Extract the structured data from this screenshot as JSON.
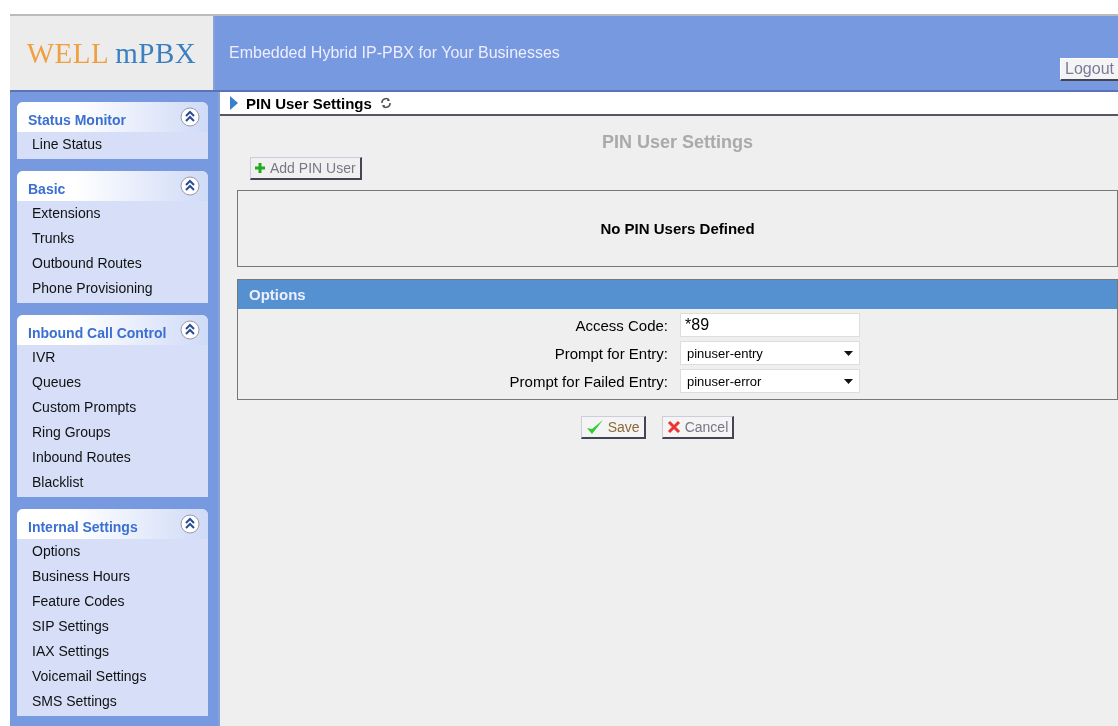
{
  "header": {
    "logo": {
      "part_1": "WELL",
      "part_2": "mPBX"
    },
    "tagline": "Embedded Hybrid IP-PBX for Your Businesses",
    "logout": "Logout"
  },
  "sidebar": {
    "sections": [
      {
        "title": "Status Monitor",
        "expanded": true,
        "items": [
          "Line Status"
        ]
      },
      {
        "title": "Basic",
        "expanded": true,
        "items": [
          "Extensions",
          "Trunks",
          "Outbound Routes",
          "Phone Provisioning"
        ]
      },
      {
        "title": "Inbound Call Control",
        "expanded": true,
        "items": [
          "IVR",
          "Queues",
          "Custom Prompts",
          "Ring Groups",
          "Inbound Routes",
          "Blacklist"
        ]
      },
      {
        "title": "Internal Settings",
        "expanded": true,
        "items": [
          "Options",
          "Business Hours",
          "Feature Codes",
          "SIP Settings",
          "IAX Settings",
          "Voicemail Settings",
          "SMS Settings"
        ]
      }
    ]
  },
  "breadcrumb": "PIN User Settings",
  "page_title": "PIN User Settings",
  "add_button": "Add PIN User",
  "empty_message": "No PIN Users Defined",
  "options": {
    "title": "Options",
    "fields": [
      {
        "kind": "text",
        "label": "Access Code:",
        "value": "*89"
      },
      {
        "kind": "select",
        "label": "Prompt for Entry:",
        "value": "pinuser-entry"
      },
      {
        "kind": "select",
        "label": "Prompt for Failed Entry:",
        "value": "pinuser-error"
      }
    ]
  },
  "buttons": {
    "save": "Save",
    "cancel": "Cancel"
  }
}
